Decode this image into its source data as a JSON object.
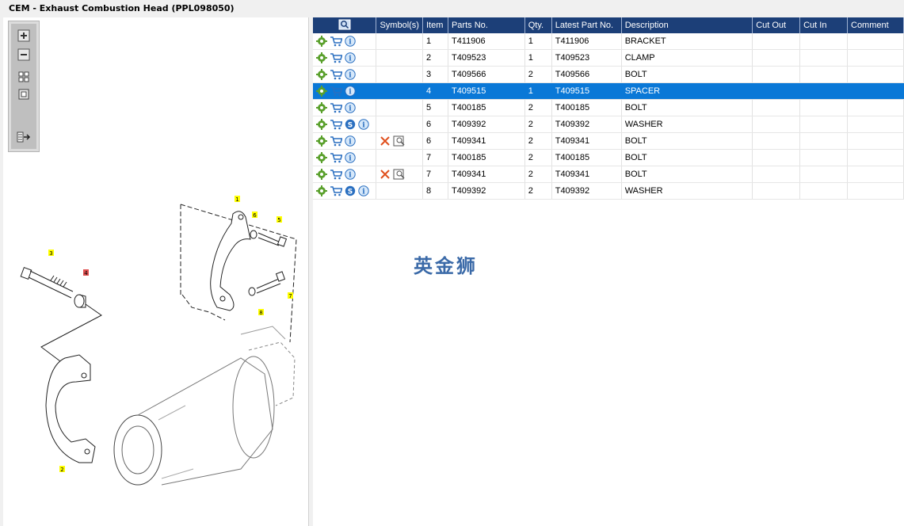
{
  "window": {
    "title": "CEM - Exhaust Combustion Head (PPL098050)"
  },
  "toolbox": {
    "buttons": [
      {
        "name": "zoom-in-icon"
      },
      {
        "name": "zoom-out-icon"
      },
      {
        "name": "fit-all-icon"
      },
      {
        "name": "fit-selection-icon"
      },
      {
        "name": "export-icon"
      }
    ]
  },
  "diagram": {
    "callouts": [
      {
        "label": "1",
        "highlighted": false
      },
      {
        "label": "6",
        "highlighted": false
      },
      {
        "label": "5",
        "highlighted": false
      },
      {
        "label": "7",
        "highlighted": false
      },
      {
        "label": "8",
        "highlighted": false
      },
      {
        "label": "3",
        "highlighted": false
      },
      {
        "label": "4",
        "highlighted": true
      },
      {
        "label": "2",
        "highlighted": false
      }
    ],
    "colors": {
      "callout": "#ffff00",
      "callout_selected": "#e05050"
    }
  },
  "table": {
    "columns": [
      "Symbol(s)",
      "Item",
      "Parts No.",
      "Qty.",
      "Latest Part No.",
      "Description",
      "Cut Out",
      "Cut In",
      "Comment"
    ],
    "rows": [
      {
        "item": "1",
        "part": "T411906",
        "qty": "1",
        "latest": "T411906",
        "desc": "BRACKET",
        "s_icon": false,
        "symbols": false,
        "selected": false
      },
      {
        "item": "2",
        "part": "T409523",
        "qty": "1",
        "latest": "T409523",
        "desc": "CLAMP",
        "s_icon": false,
        "symbols": false,
        "selected": false
      },
      {
        "item": "3",
        "part": "T409566",
        "qty": "2",
        "latest": "T409566",
        "desc": "BOLT",
        "s_icon": false,
        "symbols": false,
        "selected": false
      },
      {
        "item": "4",
        "part": "T409515",
        "qty": "1",
        "latest": "T409515",
        "desc": "SPACER",
        "s_icon": false,
        "symbols": false,
        "selected": true
      },
      {
        "item": "5",
        "part": "T400185",
        "qty": "2",
        "latest": "T400185",
        "desc": "BOLT",
        "s_icon": false,
        "symbols": false,
        "selected": false
      },
      {
        "item": "6",
        "part": "T409392",
        "qty": "2",
        "latest": "T409392",
        "desc": "WASHER",
        "s_icon": true,
        "symbols": false,
        "selected": false
      },
      {
        "item": "6",
        "part": "T409341",
        "qty": "2",
        "latest": "T409341",
        "desc": "BOLT",
        "s_icon": false,
        "symbols": true,
        "selected": false
      },
      {
        "item": "7",
        "part": "T400185",
        "qty": "2",
        "latest": "T400185",
        "desc": "BOLT",
        "s_icon": false,
        "symbols": false,
        "selected": false
      },
      {
        "item": "7",
        "part": "T409341",
        "qty": "2",
        "latest": "T409341",
        "desc": "BOLT",
        "s_icon": false,
        "symbols": true,
        "selected": false
      },
      {
        "item": "8",
        "part": "T409392",
        "qty": "2",
        "latest": "T409392",
        "desc": "WASHER",
        "s_icon": true,
        "symbols": false,
        "selected": false
      }
    ]
  },
  "watermark": {
    "text": "英金狮"
  },
  "colors": {
    "header": "#1c3f78",
    "selected_row": "#0a78d7",
    "watermark": "#3b6aa8"
  }
}
